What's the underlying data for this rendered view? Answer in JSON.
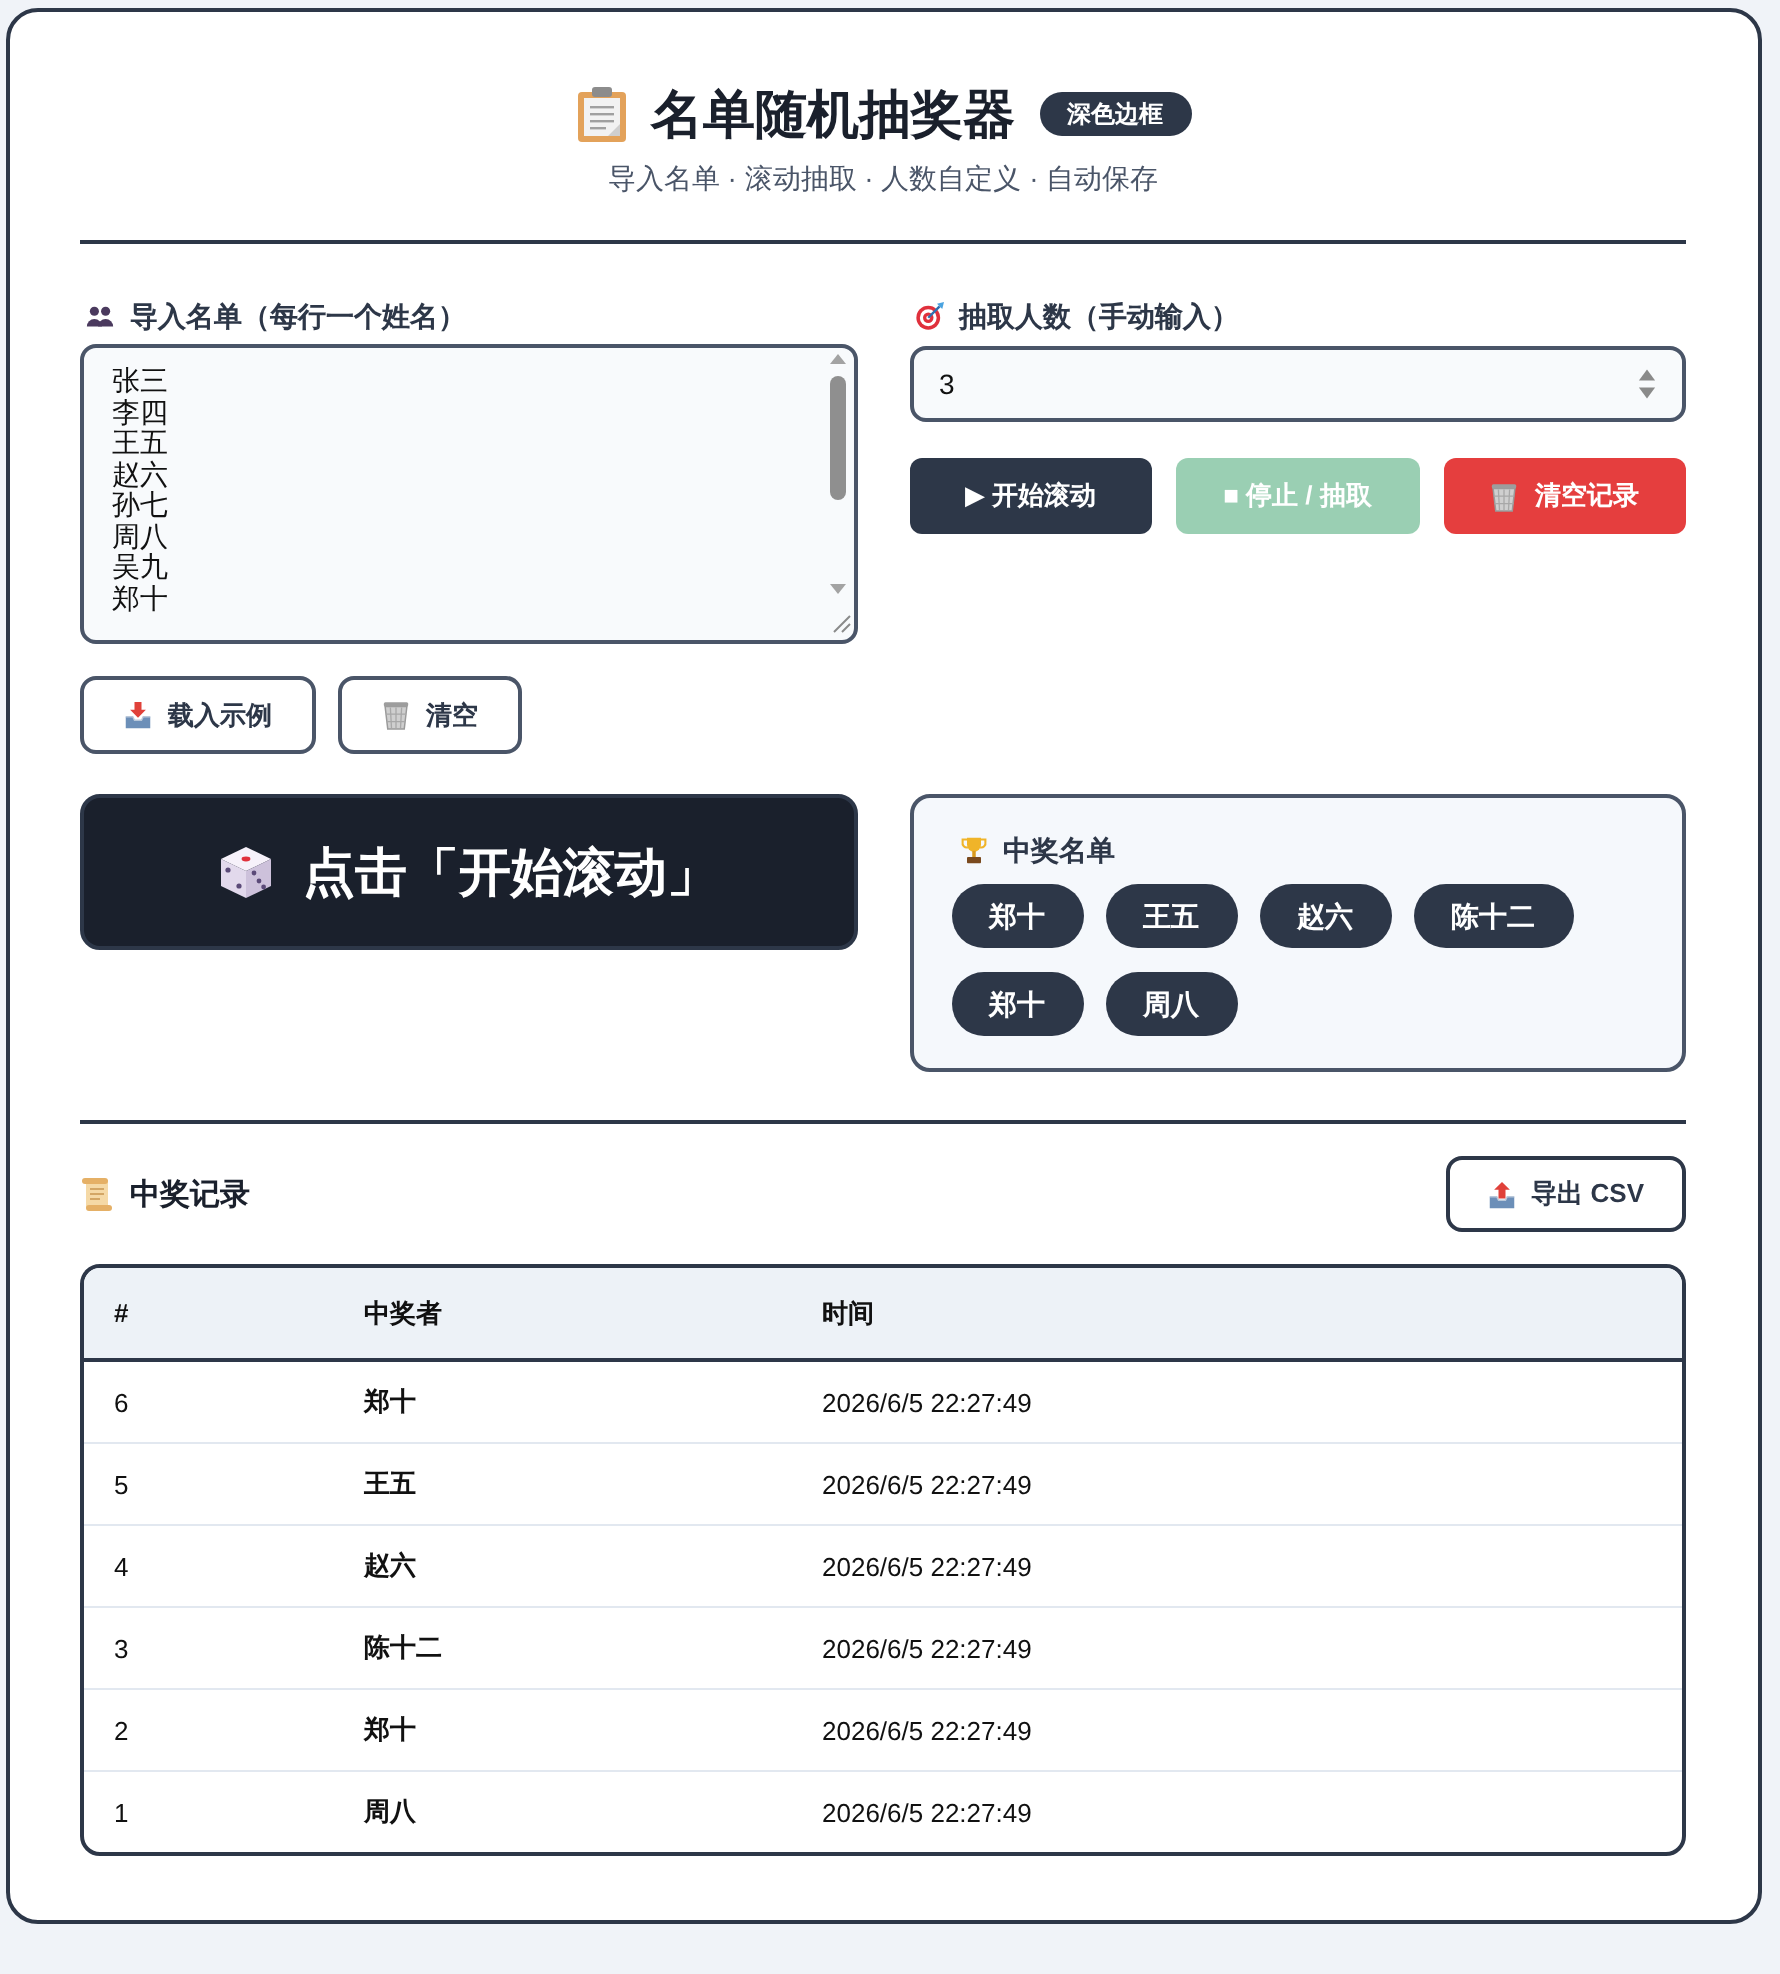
{
  "header": {
    "title": "名单随机抽奖器",
    "badge": "深色边框",
    "subtitle": "导入名单 · 滚动抽取 · 人数自定义 · 自动保存"
  },
  "import": {
    "label": "导入名单（每行一个姓名）",
    "lines": [
      "张三",
      "李四",
      "王五",
      "赵六",
      "孙七",
      "周八",
      "吴九",
      "郑十"
    ],
    "buttons": [
      {
        "kind": "load",
        "label": "载入示例"
      },
      {
        "kind": "clear",
        "label": "清空"
      }
    ]
  },
  "draw": {
    "label": "抽取人数（手动输入）",
    "value": "3",
    "buttons": [
      {
        "kind": "start",
        "label": "▶ 开始滚动",
        "disabled": false
      },
      {
        "kind": "stop",
        "label": "■ 停止 / 抽取",
        "disabled": true
      },
      {
        "kind": "clear",
        "label": "清空记录",
        "disabled": false
      }
    ]
  },
  "display": {
    "text": "点击「开始滚动」"
  },
  "winners": {
    "title": "中奖名单",
    "names": [
      "郑十",
      "王五",
      "赵六",
      "陈十二",
      "郑十",
      "周八"
    ]
  },
  "records": {
    "title": "中奖记录",
    "export_button": "导出 CSV",
    "columns": [
      "#",
      "中奖者",
      "时间"
    ],
    "rows": [
      {
        "index": "6",
        "winner": "郑十",
        "time": "2026/6/5 22:27:49"
      },
      {
        "index": "5",
        "winner": "王五",
        "time": "2026/6/5 22:27:49"
      },
      {
        "index": "4",
        "winner": "赵六",
        "time": "2026/6/5 22:27:49"
      },
      {
        "index": "3",
        "winner": "陈十二",
        "time": "2026/6/5 22:27:49"
      },
      {
        "index": "2",
        "winner": "郑十",
        "time": "2026/6/5 22:27:49"
      },
      {
        "index": "1",
        "winner": "周八",
        "time": "2026/6/5 22:27:49"
      }
    ]
  }
}
